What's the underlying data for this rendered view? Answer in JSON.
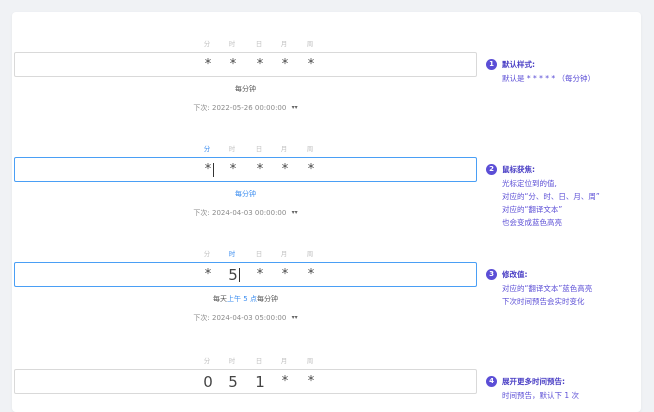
{
  "field_labels": [
    "分",
    "时",
    "日",
    "月",
    "周"
  ],
  "examples": [
    {
      "tokens": [
        "*",
        "*",
        "*",
        "*",
        "*"
      ],
      "active_label": -1,
      "translation": {
        "before": "每分钟",
        "highlight": "",
        "after": ""
      },
      "next_label": "下次:",
      "next_time": "2022-05-26 00:00:00",
      "note": {
        "number": "1",
        "title": "默认样式:",
        "lines": [
          "默认是 * * * * *  （每分钟）"
        ]
      }
    },
    {
      "tokens": [
        "*",
        "*",
        "*",
        "*",
        "*"
      ],
      "active_label": 0,
      "translation": {
        "before": "每分钟",
        "highlight": "",
        "after": ""
      },
      "next_label": "下次:",
      "next_time": "2024-04-03 00:00:00",
      "note": {
        "number": "2",
        "title": "鼠标获焦:",
        "lines": [
          "光标定位到的值,",
          "对应的“分、时、日、月、周”",
          "对应的“翻译文本”",
          "也会变成蓝色高亮"
        ]
      }
    },
    {
      "tokens": [
        "*",
        "5",
        "*",
        "*",
        "*"
      ],
      "active_label": 1,
      "translation": {
        "before": "每天",
        "highlight": "上午 5 点",
        "after": "每分钟"
      },
      "next_label": "下次:",
      "next_time": "2024-04-03 05:00:00",
      "note": {
        "number": "3",
        "title": "修改值:",
        "lines": [
          "对应的“翻译文本”蓝色高亮",
          "下次时间预告会实时变化"
        ]
      }
    },
    {
      "tokens": [
        "0",
        "5",
        "1",
        "*",
        "*"
      ],
      "active_label": -1,
      "translation": {
        "before": "",
        "highlight": "",
        "after": ""
      },
      "next_label": "",
      "next_time": "",
      "note": {
        "number": "4",
        "title": "展开更多时间预告:",
        "lines": [
          "时间预告，默认下 1 次"
        ]
      }
    }
  ],
  "colors": {
    "accent": "#3b8df0",
    "note": "#5b4ed6",
    "border": "#d9d9d9"
  },
  "icons": {
    "expand": "chevron-double-down-icon"
  }
}
